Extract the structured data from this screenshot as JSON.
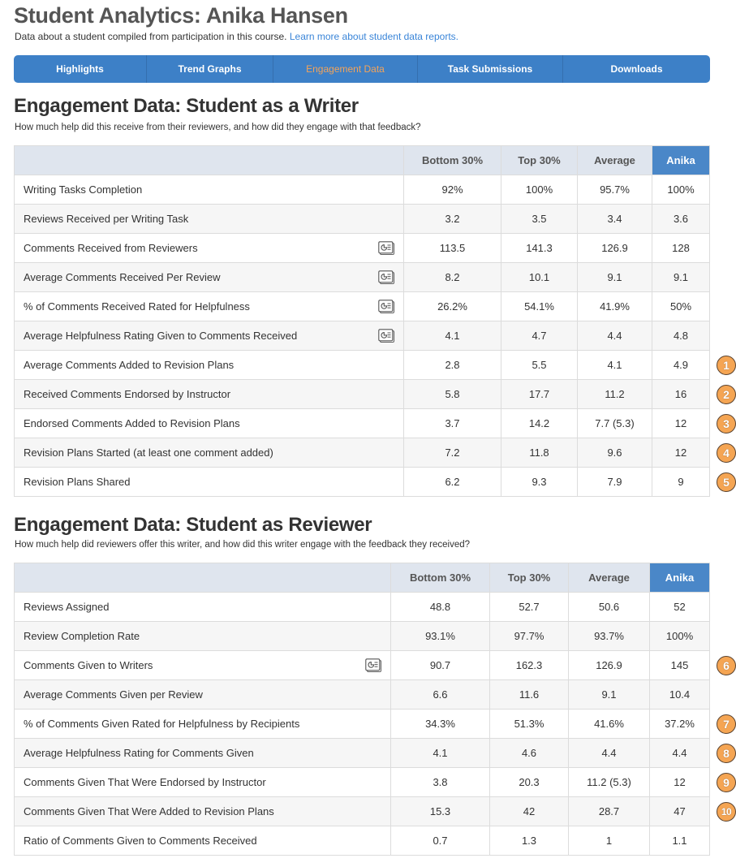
{
  "header": {
    "title": "Student Analytics: Anika Hansen",
    "subtitle": "Data about a student compiled from participation in this course.",
    "learn_more_link": "Learn more about student data reports."
  },
  "nav": {
    "tabs": [
      {
        "label": "Highlights",
        "active": false
      },
      {
        "label": "Trend Graphs",
        "active": false
      },
      {
        "label": "Engagement Data",
        "active": true
      },
      {
        "label": "Task Submissions",
        "active": false
      },
      {
        "label": "Downloads",
        "active": false
      }
    ]
  },
  "colors": {
    "nav_background": "#3d80c7",
    "active_tab_text": "#f3a35a",
    "student_header": "#4a87c8",
    "badge": "#f5a553"
  },
  "writer_section": {
    "title": "Engagement Data: Student as a Writer",
    "description": "How much help did this receive from their reviewers, and how did they engage with that feedback?",
    "columns": [
      "",
      "Bottom 30%",
      "Top 30%",
      "Average",
      "Anika"
    ],
    "rows": [
      {
        "label": "Writing Tasks Completion",
        "icon": null,
        "values": [
          "92%",
          "100%",
          "95.7%",
          "100%"
        ],
        "badge": null
      },
      {
        "label": "Reviews Received per Writing Task",
        "icon": null,
        "values": [
          "3.2",
          "3.5",
          "3.4",
          "3.6"
        ],
        "badge": null
      },
      {
        "label": "Comments Received from Reviewers",
        "icon": "report-chart-icon",
        "values": [
          "113.5",
          "141.3",
          "126.9",
          "128"
        ],
        "badge": null
      },
      {
        "label": "Average Comments Received Per Review",
        "icon": "report-chart-icon",
        "values": [
          "8.2",
          "10.1",
          "9.1",
          "9.1"
        ],
        "badge": null
      },
      {
        "label": "% of Comments Received Rated for Helpfulness",
        "icon": "report-chart-icon",
        "values": [
          "26.2%",
          "54.1%",
          "41.9%",
          "50%"
        ],
        "badge": null
      },
      {
        "label": "Average Helpfulness Rating Given to Comments Received",
        "icon": "report-chart-icon",
        "values": [
          "4.1",
          "4.7",
          "4.4",
          "4.8"
        ],
        "badge": null
      },
      {
        "label": "Average Comments Added to Revision Plans",
        "icon": null,
        "values": [
          "2.8",
          "5.5",
          "4.1",
          "4.9"
        ],
        "badge": "1"
      },
      {
        "label": "Received Comments Endorsed by Instructor",
        "icon": null,
        "values": [
          "5.8",
          "17.7",
          "11.2",
          "16"
        ],
        "badge": "2"
      },
      {
        "label": "Endorsed Comments Added to Revision Plans",
        "icon": null,
        "values": [
          "3.7",
          "14.2",
          "7.7 (5.3)",
          "12"
        ],
        "badge": "3"
      },
      {
        "label": "Revision Plans Started (at least one comment added)",
        "icon": null,
        "values": [
          "7.2",
          "11.8",
          "9.6",
          "12"
        ],
        "badge": "4"
      },
      {
        "label": "Revision Plans Shared",
        "icon": null,
        "values": [
          "6.2",
          "9.3",
          "7.9",
          "9"
        ],
        "badge": "5"
      }
    ]
  },
  "reviewer_section": {
    "title": "Engagement Data: Student as Reviewer",
    "description": "How much help did reviewers offer this writer, and how did this writer engage with the feedback they received?",
    "columns": [
      "",
      "Bottom 30%",
      "Top 30%",
      "Average",
      "Anika"
    ],
    "rows": [
      {
        "label": "Reviews Assigned",
        "icon": null,
        "values": [
          "48.8",
          "52.7",
          "50.6",
          "52"
        ],
        "badge": null
      },
      {
        "label": "Review Completion Rate",
        "icon": null,
        "values": [
          "93.1%",
          "97.7%",
          "93.7%",
          "100%"
        ],
        "badge": null
      },
      {
        "label": "Comments Given to Writers",
        "icon": "report-chart-icon",
        "values": [
          "90.7",
          "162.3",
          "126.9",
          "145"
        ],
        "badge": "6"
      },
      {
        "label": "Average Comments Given per Review",
        "icon": null,
        "values": [
          "6.6",
          "11.6",
          "9.1",
          "10.4"
        ],
        "badge": null
      },
      {
        "label": "% of Comments Given Rated for Helpfulness by Recipients",
        "icon": null,
        "values": [
          "34.3%",
          "51.3%",
          "41.6%",
          "37.2%"
        ],
        "badge": "7"
      },
      {
        "label": "Average Helpfulness Rating for Comments Given",
        "icon": null,
        "values": [
          "4.1",
          "4.6",
          "4.4",
          "4.4"
        ],
        "badge": "8"
      },
      {
        "label": "Comments Given That Were Endorsed by Instructor",
        "icon": null,
        "values": [
          "3.8",
          "20.3",
          "11.2 (5.3)",
          "12"
        ],
        "badge": "9"
      },
      {
        "label": "Comments Given That Were Added to Revision Plans",
        "icon": null,
        "values": [
          "15.3",
          "42",
          "28.7",
          "47"
        ],
        "badge": "10"
      },
      {
        "label": "Ratio of Comments Given to Comments Received",
        "icon": null,
        "values": [
          "0.7",
          "1.3",
          "1",
          "1.1"
        ],
        "badge": null
      }
    ]
  }
}
